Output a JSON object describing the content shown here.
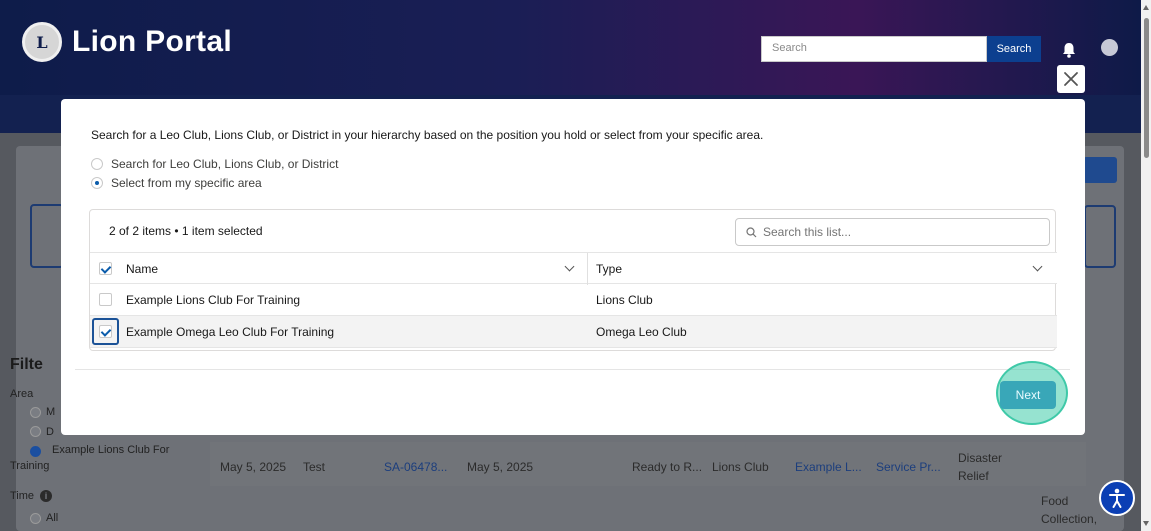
{
  "app": {
    "title": "Lion Portal",
    "logo_text": "L",
    "search_placeholder": "Search",
    "search_button": "Search"
  },
  "background": {
    "filter_title": "Filte",
    "area_label": "Area",
    "area_option_1": "M",
    "area_option_2": "D",
    "area_option_3_line1": "Example Lions Club For",
    "area_option_3_line2": "Training",
    "time_label": "Time",
    "time_option_all": "All",
    "row": {
      "date": "May 5, 2025",
      "name": "Test",
      "id": "SA-06478...",
      "date2": "May 5, 2025",
      "status": "Ready to R...",
      "club_type": "Lions Club",
      "club": "Example L...",
      "project": "Service Pr...",
      "cause_line1": "Disaster",
      "cause_line2": "Relief",
      "extra_line1": "Food",
      "extra_line2": "Collection,"
    }
  },
  "modal": {
    "instruction": "Search for a Leo Club, Lions Club, or District in your hierarchy based on the position you hold or select from your specific area.",
    "options": [
      {
        "label": "Search for Leo Club, Lions Club, or District",
        "checked": false
      },
      {
        "label": "Select from my specific area",
        "checked": true
      }
    ],
    "list": {
      "count_text": "2 of 2 items • 1 item selected",
      "search_placeholder": "Search this list...",
      "columns": [
        "Name",
        "Type"
      ],
      "rows": [
        {
          "name": "Example Lions Club For Training",
          "type": "Lions Club",
          "selected": false
        },
        {
          "name": "Example Omega Leo Club For Training",
          "type": "Omega Leo Club",
          "selected": true
        }
      ]
    },
    "next_label": "Next",
    "close_label": "×"
  },
  "colors": {
    "accent": "#0b5cab",
    "next_button": "#39a7b8",
    "highlight_ring": "#3fc9a8"
  }
}
